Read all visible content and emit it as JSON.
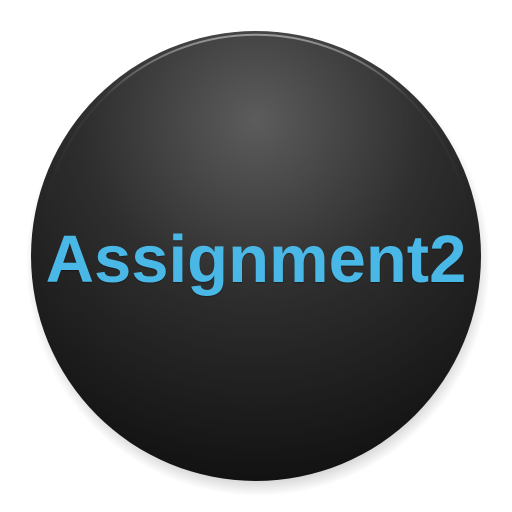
{
  "app_icon": {
    "label": "Assignment2",
    "label_color": "#4ab8e6",
    "base_color": "#2a2a2a",
    "highlight_color": "#5a5a5a",
    "icon_name": "round-launcher-icon"
  }
}
